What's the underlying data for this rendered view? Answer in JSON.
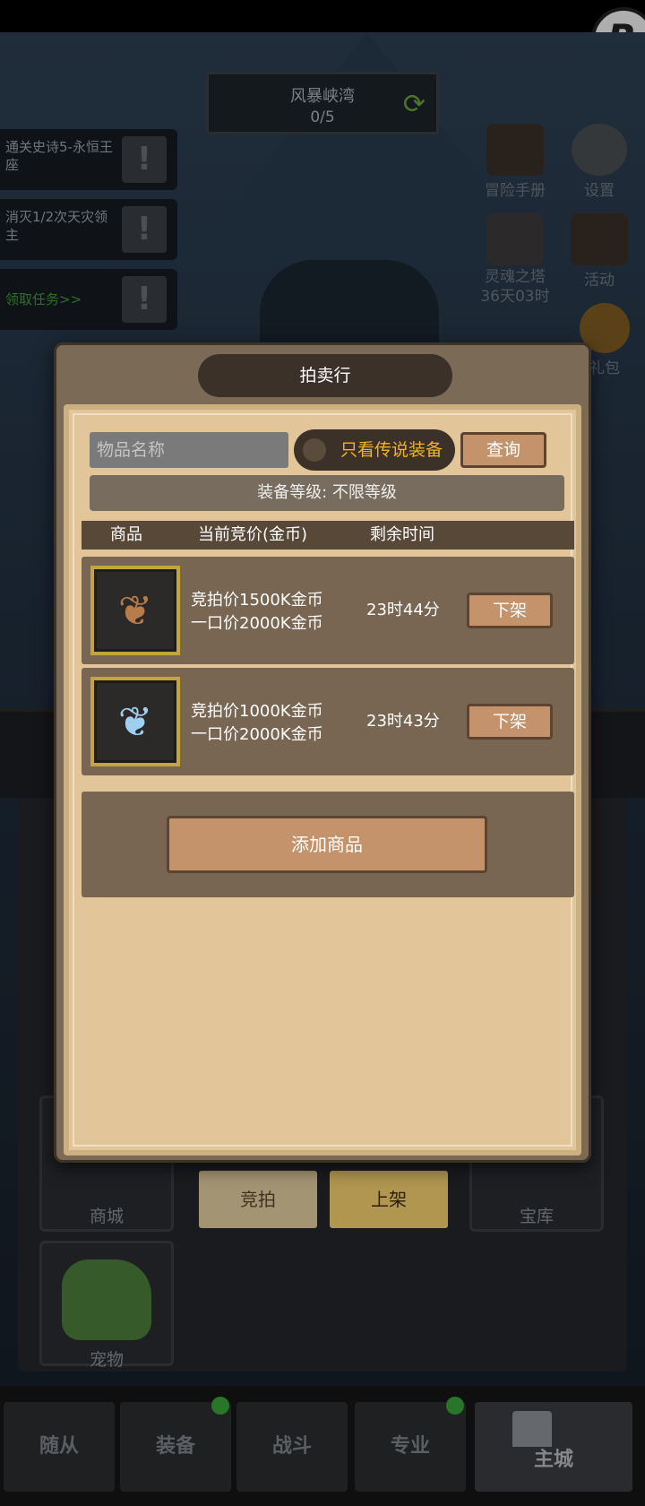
{
  "corner_logo": "R",
  "region": {
    "name": "风暴峡湾",
    "progress": "0/5"
  },
  "quests": [
    {
      "text": "通关史诗5-永恒王座"
    },
    {
      "text": "消灭1/2次天灾领主"
    },
    {
      "text": "领取任务>>"
    }
  ],
  "side_icons": {
    "adventure_manual": "冒险手册",
    "settings": "设置",
    "soul_tower": "灵魂之塔",
    "soul_tower_timer": "36天03时",
    "activity": "活动",
    "gift_pack_partial": "礼包"
  },
  "background_tiles": {
    "shop": "商城",
    "treasury": "宝库",
    "pet_partial": "宠物"
  },
  "auction_sub_buttons": {
    "bid": "竞拍",
    "list": "上架"
  },
  "auction": {
    "title": "拍卖行",
    "search_placeholder": "物品名称",
    "legend_only_toggle": "只看传说装备",
    "query_button": "查询",
    "level_filter": "装备等级: 不限等级",
    "columns": {
      "item": "商品",
      "current_bid": "当前竞价(金币)",
      "time_left": "剩余时间"
    },
    "listings": [
      {
        "icon": "bronze-wings-icon",
        "bid_price": "竞拍价1500K金币",
        "buyout_price": "一口价2000K金币",
        "time_left": "23时44分",
        "action": "下架"
      },
      {
        "icon": "silver-wings-icon",
        "bid_price": "竞拍价1000K金币",
        "buyout_price": "一口价2000K金币",
        "time_left": "23时43分",
        "action": "下架"
      }
    ],
    "add_item_button": "添加商品"
  },
  "bottom_nav": {
    "followers": "随从",
    "equipment": "装备",
    "battle": "战斗",
    "profession": "专业",
    "main_city": "主城"
  },
  "colors": {
    "accent_gold": "#f0b22b",
    "button_tan": "#c4936b",
    "panel_parchment": "#e2c598",
    "notification_green": "#3aa33a"
  }
}
